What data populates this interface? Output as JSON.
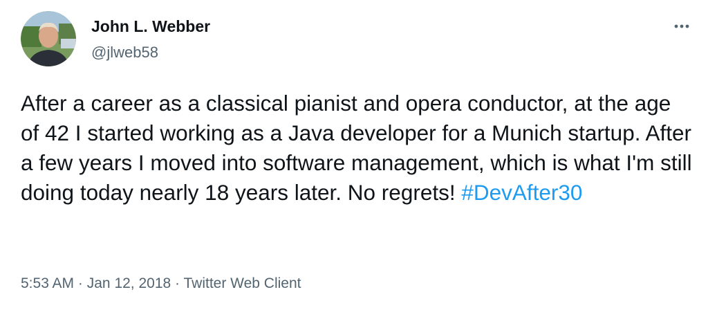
{
  "tweet": {
    "author": {
      "display_name": "John L. Webber",
      "handle": "@jlweb58"
    },
    "text": "After a career as a classical pianist and opera conductor, at the age of 42 I started working as a Java developer for a Munich startup. After a few years I moved into software management, which is what I'm still doing today nearly 18 years later. No regrets! ",
    "hashtag": "#DevAfter30",
    "time": "5:53 AM",
    "separator": "·",
    "date": "Jan 12, 2018",
    "source": "Twitter Web Client"
  },
  "icons": {
    "more": "more-horizontal-icon",
    "avatar": "avatar-photo"
  },
  "colors": {
    "text": "#0f1419",
    "secondary": "#536471",
    "link": "#1d9bf0",
    "background": "#ffffff"
  }
}
